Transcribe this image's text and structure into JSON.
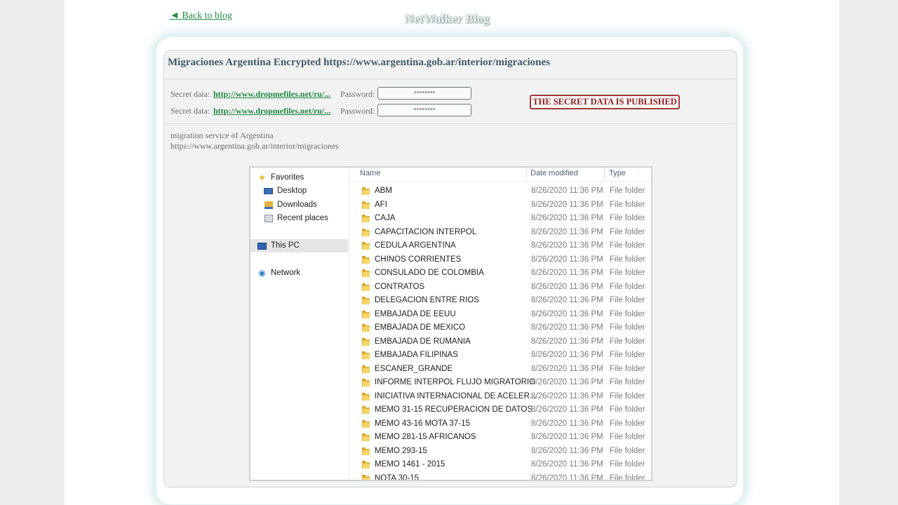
{
  "header": {
    "back_link": "◄ Back to blog",
    "site_title": "NetWalker Blog"
  },
  "post": {
    "title": "Migraciones Argentina Encrypted https://www.argentina.gob.ar/interior/migraciones",
    "secrets": [
      {
        "label": "Secret data:",
        "link": "http://www.dropmefiles.net/ru/...",
        "password_label": "Password:",
        "password_value": "••••••••"
      },
      {
        "label": "Secret data:",
        "link": "http://www.dropmefiles.net/ru/...",
        "password_label": "Password:",
        "password_value": "••••••••"
      }
    ],
    "status_badge": "THE SECRET DATA IS PUBLISHED",
    "description": [
      "migration service of Argentina",
      "https://www.argentina.gob.ar/interior/migraciones"
    ]
  },
  "explorer": {
    "nav": {
      "favorites": "Favorites",
      "desktop": "Desktop",
      "downloads": "Downloads",
      "recent_places": "Recent places",
      "this_pc": "This PC",
      "network": "Network"
    },
    "columns": {
      "name": "Name",
      "date_modified": "Date modified",
      "type": "Type"
    },
    "rows": [
      {
        "name": "ABM",
        "date": "8/26/2020 11:36 PM",
        "type": "File folder"
      },
      {
        "name": "AFI",
        "date": "8/26/2020 11:36 PM",
        "type": "File folder"
      },
      {
        "name": "CAJA",
        "date": "8/26/2020 11:36 PM",
        "type": "File folder"
      },
      {
        "name": "CAPACITACION INTERPOL",
        "date": "8/26/2020 11:36 PM",
        "type": "File folder"
      },
      {
        "name": "CEDULA ARGENTINA",
        "date": "8/26/2020 11:36 PM",
        "type": "File folder"
      },
      {
        "name": "CHINOS CORRIENTES",
        "date": "8/26/2020 11:36 PM",
        "type": "File folder"
      },
      {
        "name": "CONSULADO DE COLOMBIA",
        "date": "8/26/2020 11:36 PM",
        "type": "File folder"
      },
      {
        "name": "CONTRATOS",
        "date": "8/26/2020 11:36 PM",
        "type": "File folder"
      },
      {
        "name": "DELEGACION ENTRE RIOS",
        "date": "8/26/2020 11:36 PM",
        "type": "File folder"
      },
      {
        "name": "EMBAJADA DE EEUU",
        "date": "8/26/2020 11:36 PM",
        "type": "File folder"
      },
      {
        "name": "EMBAJADA DE MEXICO",
        "date": "8/26/2020 11:36 PM",
        "type": "File folder"
      },
      {
        "name": "EMBAJADA DE RUMANIA",
        "date": "8/26/2020 11:36 PM",
        "type": "File folder"
      },
      {
        "name": "EMBAJADA FILIPINAS",
        "date": "8/26/2020 11:36 PM",
        "type": "File folder"
      },
      {
        "name": "ESCANER_GRANDE",
        "date": "8/26/2020 11:36 PM",
        "type": "File folder"
      },
      {
        "name": "INFORME INTERPOL FLUJO MIGRATORIO",
        "date": "8/26/2020 11:36 PM",
        "type": "File folder"
      },
      {
        "name": "INICIATIVA INTERNACIONAL DE ACELER...",
        "date": "8/26/2020 11:36 PM",
        "type": "File folder"
      },
      {
        "name": "MEMO 31-15 RECUPERACION DE DATOS",
        "date": "8/26/2020 11:36 PM",
        "type": "File folder"
      },
      {
        "name": "MEMO 43-16 MOTA 37-15",
        "date": "8/26/2020 11:36 PM",
        "type": "File folder"
      },
      {
        "name": "MEMO 281-15 AFRICANOS",
        "date": "8/26/2020 11:36 PM",
        "type": "File folder"
      },
      {
        "name": "MEMO 293-15",
        "date": "8/26/2020 11:36 PM",
        "type": "File folder"
      },
      {
        "name": "MEMO 1461 - 2015",
        "date": "8/26/2020 11:36 PM",
        "type": "File folder"
      },
      {
        "name": "NOTA 30-15",
        "date": "8/26/2020 11:36 PM",
        "type": "File folder"
      }
    ]
  },
  "colors": {
    "link": "#1f8a3e",
    "title": "#3e5b6c",
    "badge": "#8b1e1e",
    "folder": "#e2b33a"
  }
}
